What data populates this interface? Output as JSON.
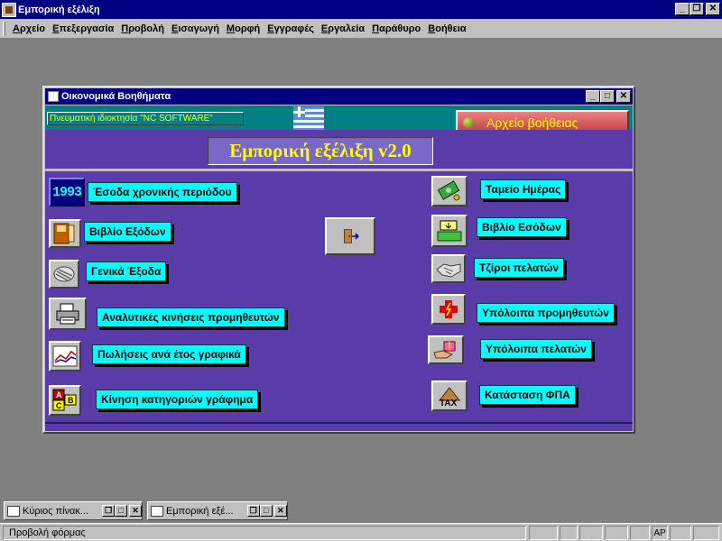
{
  "app": {
    "title": "Εμπορική εξέλιξη",
    "menu": [
      "Αρχείο",
      "Επεξεργασία",
      "Προβολή",
      "Εισαγωγή",
      "Μορφή",
      "Εγγραφές",
      "Εργαλεία",
      "Παράθυρο",
      "Βοήθεια"
    ]
  },
  "form": {
    "title": "Οικονομικά Βοηθήματα",
    "copyright": "Πνευματική ιδιοκτησία \"NC SOFTWARE\"",
    "help_button": "Αρχείο βοήθειας",
    "app_title": "Εμπορική εξέλιξη  v2.0",
    "left_items": [
      {
        "label": "Έσοδα χρονικής περιόδου",
        "icon": "calendar-1993-icon",
        "icon_text": "1993"
      },
      {
        "label": "Βιβλίο Εξόδων",
        "icon": "ledger-book-icon"
      },
      {
        "label": "Γενικά Έξοδα",
        "icon": "coins-icon"
      },
      {
        "label": "Αναλυτικές κινήσεις προμηθευτών",
        "icon": "printer-icon"
      },
      {
        "label": "Πωλήσεις ανά έτος γραφικά",
        "icon": "line-chart-icon"
      },
      {
        "label": "Κίνηση κατηγοριών γράφημα",
        "icon": "abc-blocks-icon",
        "icon_letters": [
          "A",
          "B",
          "C"
        ]
      }
    ],
    "right_items": [
      {
        "label": "Ταμείο Ημέρας",
        "icon": "money-icon"
      },
      {
        "label": "Βιβλίο Εσόδων",
        "icon": "cash-register-icon"
      },
      {
        "label": "Τζίροι πελατών",
        "icon": "handshake-icon"
      },
      {
        "label": "Υπόλοιπα προμηθευτών",
        "icon": "red-cross-icon"
      },
      {
        "label": "Υπόλοιπα πελατών",
        "icon": "gift-hand-icon"
      },
      {
        "label": "Κατάσταση ΦΠΑ",
        "icon": "tax-icon",
        "icon_text": "TAX"
      }
    ],
    "exit_icon": "exit-door-icon"
  },
  "taskbar": [
    {
      "title": "Κύριος πίνακ..."
    },
    {
      "title": "Εμπορική εξέ..."
    }
  ],
  "status": {
    "text": "Προβολή φόρμας",
    "indicator": "AP"
  },
  "colors": {
    "titlebar": "#000080",
    "form_body": "#5a3ca8",
    "header": "#008080",
    "label_bg": "#00ffff",
    "accent_text": "#ffff00"
  }
}
